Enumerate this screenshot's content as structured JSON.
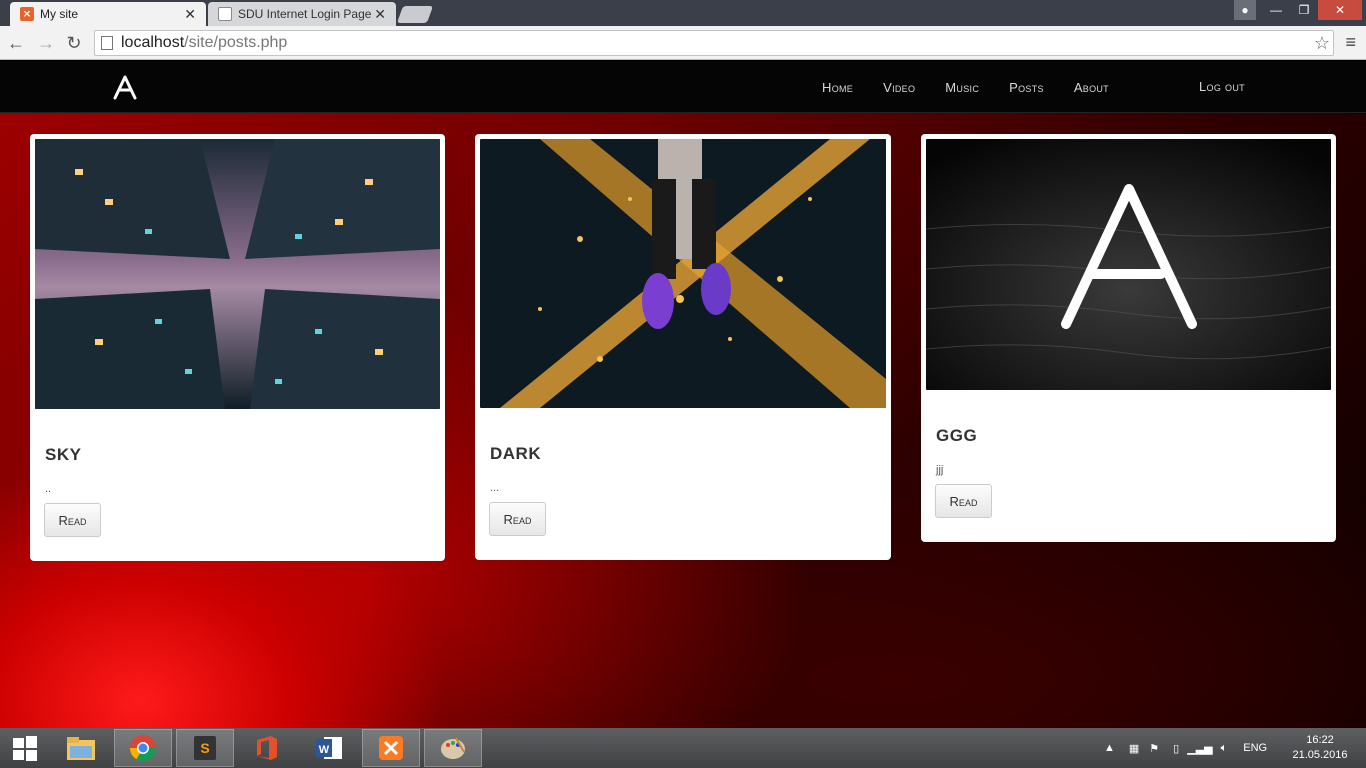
{
  "browser": {
    "tabs": [
      {
        "label": "My site",
        "active": true,
        "icon": "xampp-icon"
      },
      {
        "label": "SDU Internet Login Page",
        "active": false,
        "icon": "page-icon"
      }
    ],
    "url_host": "localhost",
    "url_path": "/site/posts.php"
  },
  "site": {
    "nav": {
      "home": "Home",
      "video": "Video",
      "music": "Music",
      "posts": "Posts",
      "about": "About",
      "logout": "Log out"
    },
    "posts": [
      {
        "title": "SKY",
        "excerpt": "..",
        "read_label": "Read",
        "image": "skyscrapers-looking-up"
      },
      {
        "title": "DARK",
        "excerpt": "...",
        "read_label": "Read",
        "image": "city-from-above-with-feet"
      },
      {
        "title": "GGG",
        "excerpt": "jjj",
        "read_label": "Read",
        "image": "logo-on-dark-water"
      }
    ]
  },
  "taskbar": {
    "apps": [
      "start-icon",
      "file-explorer-icon",
      "chrome-icon",
      "sublime-icon",
      "office-icon",
      "word-icon",
      "xampp-icon",
      "paint-icon"
    ],
    "lang": "ENG",
    "time": "16:22",
    "date": "21.05.2016"
  },
  "colors": {
    "accent_red": "#b30000",
    "navbar_bg": "#050505",
    "taskbar_bg": "#4a4c4e"
  }
}
